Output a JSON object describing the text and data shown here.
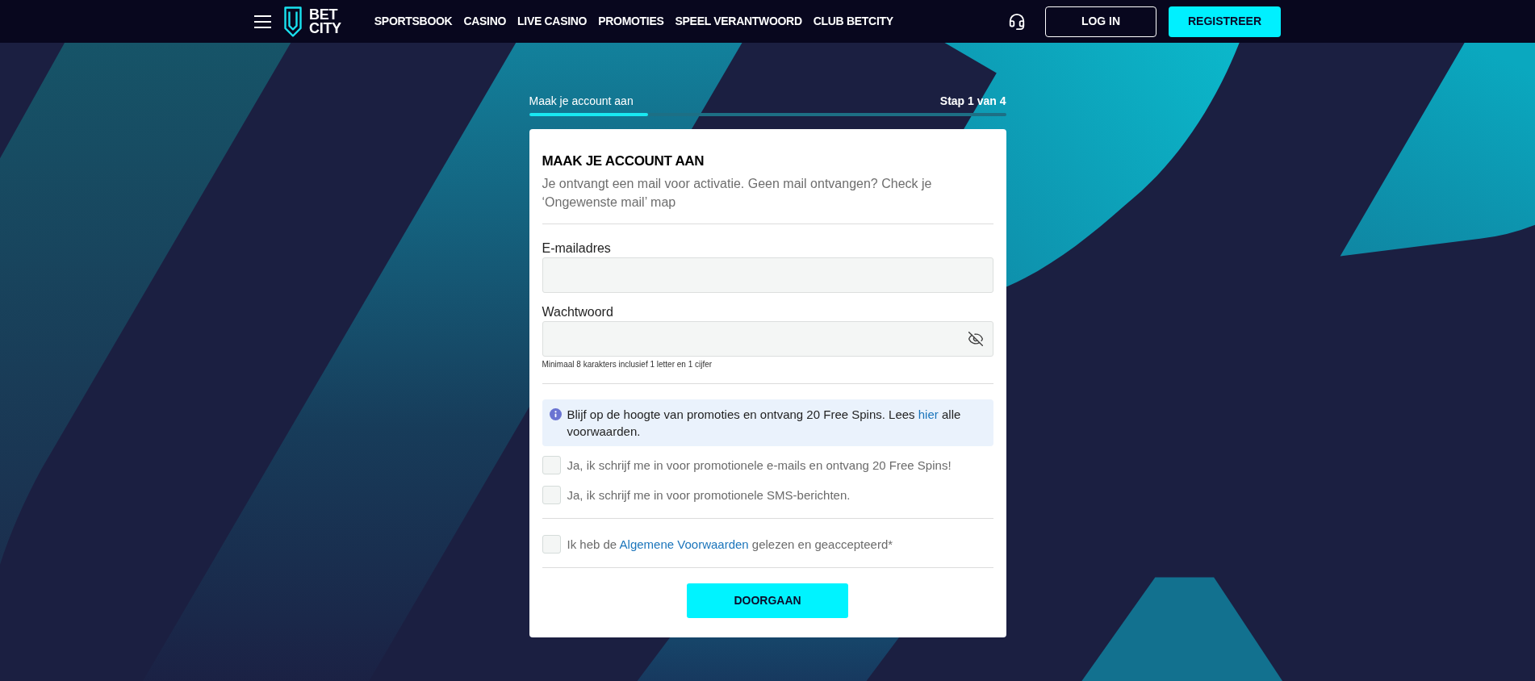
{
  "header": {
    "logo": {
      "lines": [
        "BET",
        "CITY"
      ]
    },
    "nav": [
      "SPORTSBOOK",
      "CASINO",
      "LIVE CASINO",
      "PROMOTIES",
      "SPEEL VERANTWOORD",
      "CLUB BETCITY"
    ],
    "login": "LOG IN",
    "register": "REGISTREER"
  },
  "progress": {
    "label": "Maak je account aan",
    "step": "Stap 1 van 4",
    "level": 0.25
  },
  "form": {
    "title": "MAAK JE ACCOUNT AAN",
    "subtitle": "Je ontvangt een mail voor activatie. Geen mail ontvangen? Check je ‘Ongewenste mail’ map",
    "fields": [
      {
        "kind": "email",
        "label": "E-mailadres"
      },
      {
        "kind": "password",
        "label": "Wachtwoord",
        "hint": "Minimaal 8 karakters inclusief 1 letter en 1 cijfer"
      }
    ],
    "info": {
      "before": "Blijf op de hoogte van promoties en ontvang 20 Free Spins. Lees ",
      "link": "hier",
      "after": " alle voorwaarden."
    },
    "consents": [
      {
        "label": "Ja, ik schrijf me in voor promotionele e-mails en ontvang 20 Free Spins!",
        "checked": false
      },
      {
        "label": "Ja, ik schrijf me in voor promotionele SMS-berichten.",
        "checked": false
      }
    ],
    "terms": {
      "before": "Ik heb de ",
      "link": "Algemene Voorwaarden",
      "after": " gelezen en geaccepteerd*",
      "checked": false
    },
    "submit": "DOORGAAN"
  }
}
